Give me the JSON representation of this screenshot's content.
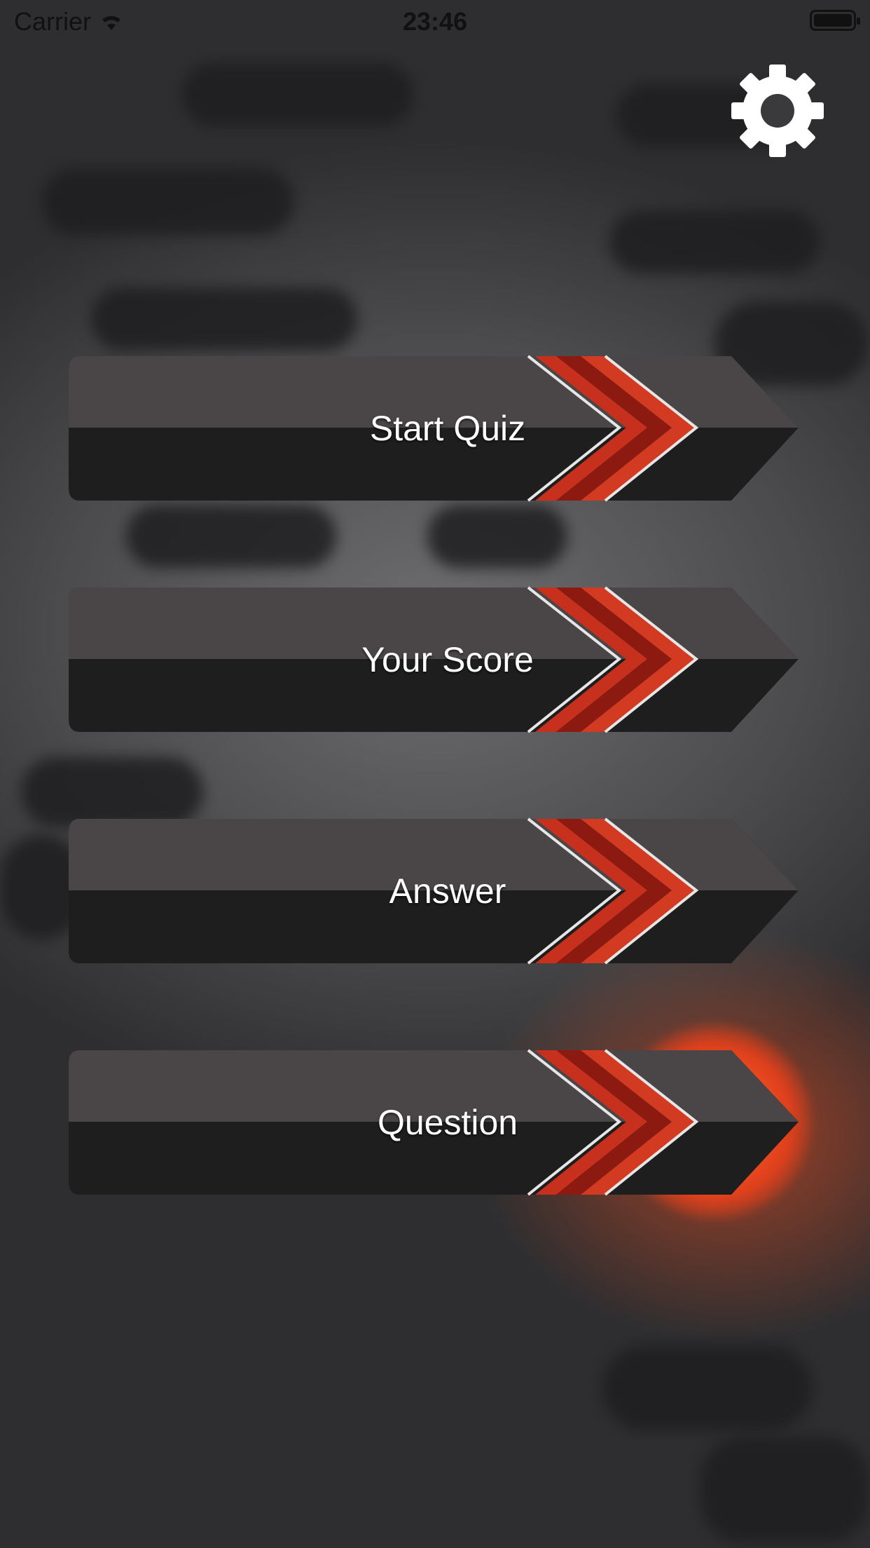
{
  "status_bar": {
    "carrier": "Carrier",
    "time": "23:46",
    "wifi_icon": "wifi-icon",
    "battery_icon": "battery-icon"
  },
  "header": {
    "settings_icon": "gear-icon"
  },
  "menu": {
    "items": [
      {
        "label": "Start Quiz"
      },
      {
        "label": "Your Score"
      },
      {
        "label": "Answer"
      },
      {
        "label": "Question"
      }
    ]
  },
  "colors": {
    "button_dark": "#1f1e1f",
    "button_light": "#4a4546",
    "chevron_red": "#c8301e",
    "accent_orange": "#ff6a2a",
    "text": "#ffffff"
  }
}
